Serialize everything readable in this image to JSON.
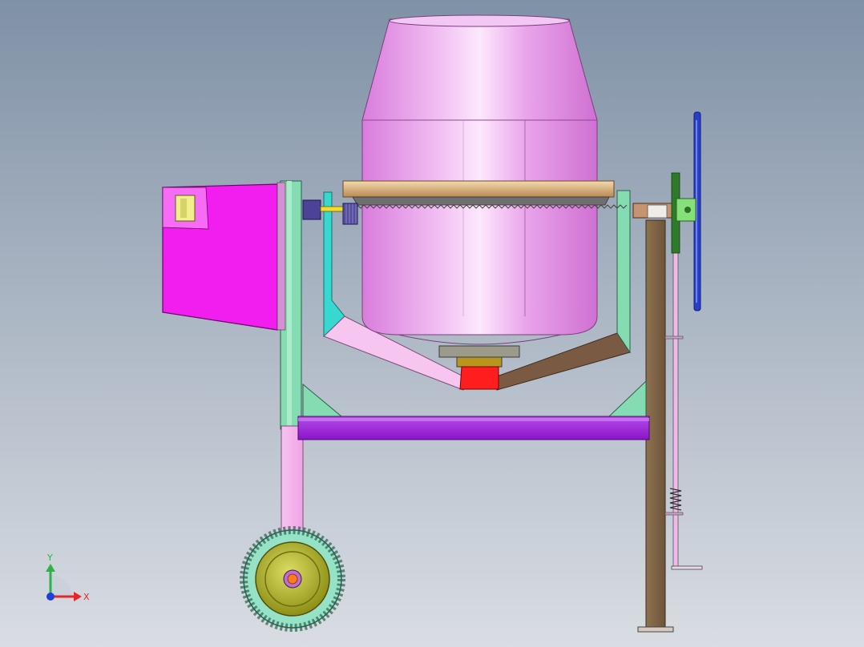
{
  "triad": {
    "x_label": "X",
    "y_label": "Y",
    "x_color": "#e3262b",
    "y_color": "#2bb34a",
    "z_color": "#1e3fd8"
  },
  "palette": {
    "drum": "#e79ae9",
    "drum_highlight": "#fbe2fc",
    "ring_gear": "#d8b17a",
    "motor_box": "#f21ef0",
    "frame_pink": "#f6b8ef",
    "frame_green": "#86dcb2",
    "frame_cyan": "#37d8d0",
    "crossbar": "#a323e0",
    "right_leg": "#7e6447",
    "bearing_red": "#ff1d1d",
    "wheel_tread": "#96e2c7",
    "wheel_hub": "#bdbf2a",
    "handwheel": "#2a3fc8"
  }
}
